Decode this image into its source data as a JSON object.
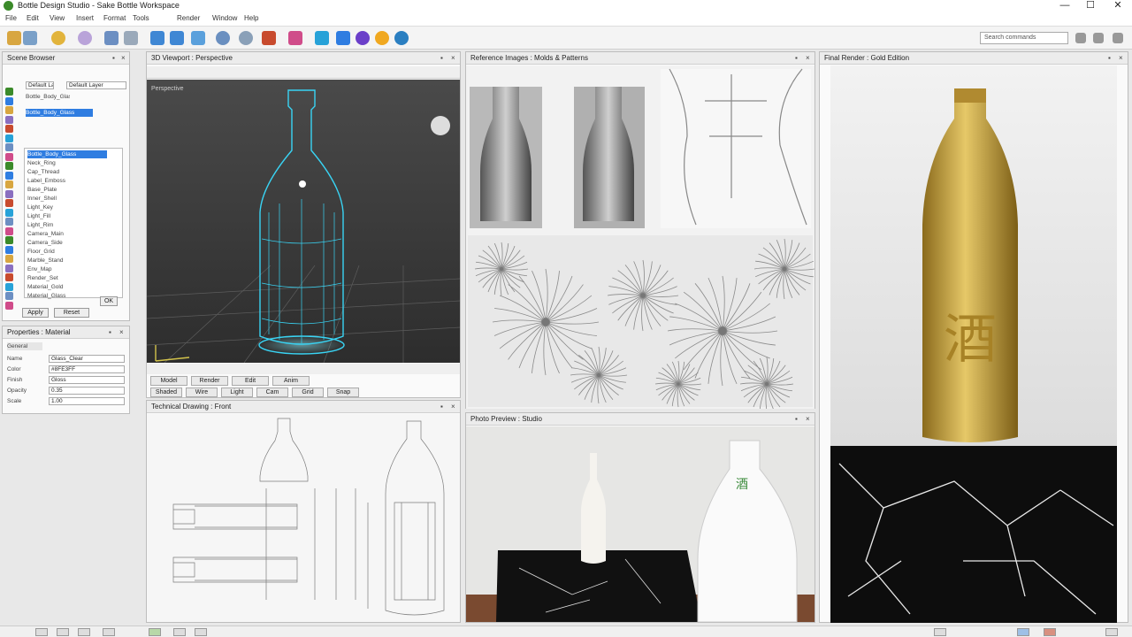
{
  "window": {
    "title": "Bottle Design Studio - Sake Bottle Workspace",
    "minimize": "—",
    "maximize": "☐",
    "close": "✕"
  },
  "menu": [
    "File",
    "Edit",
    "View",
    "Insert",
    "Format",
    "Tools",
    "Render",
    "Window",
    "Help"
  ],
  "search": {
    "value": "Search commands"
  },
  "left_panel": {
    "title": "Scene Browser",
    "selected_item": "Bottle_Body_Glass",
    "field_value": "Default Layer",
    "tree_items": [
      "Bottle_Body_Glass",
      "Neck_Ring",
      "Cap_Thread",
      "Label_Emboss",
      "Base_Plate",
      "Inner_Shell",
      "Light_Key",
      "Light_Fill",
      "Light_Rim",
      "Camera_Main",
      "Camera_Side",
      "Floor_Grid",
      "Marble_Stand",
      "Env_Map",
      "Render_Set",
      "Material_Gold",
      "Material_Glass"
    ],
    "buttons": [
      "Apply",
      "Reset",
      "OK"
    ]
  },
  "properties_panel": {
    "title": "Properties : Material",
    "section": "General",
    "labels": [
      "Name",
      "Color",
      "Finish",
      "Opacity",
      "Scale"
    ],
    "values": [
      "Glass_Clear",
      "#8FE3FF",
      "Gloss",
      "0.35",
      "1.00"
    ]
  },
  "viewport": {
    "title": "3D Viewport : Perspective",
    "hud_label": "Perspective",
    "tabs": [
      "Model",
      "Render",
      "Edit",
      "Anim"
    ],
    "subtabs": [
      "Shaded",
      "Wire",
      "Light",
      "Cam",
      "Grid",
      "Snap"
    ]
  },
  "drawing": {
    "title": "Technical Drawing : Front"
  },
  "references": {
    "title": "Reference Images : Molds & Patterns"
  },
  "photo": {
    "title": "Photo Preview : Studio"
  },
  "product": {
    "title": "Final Render : Gold Edition"
  },
  "colors": {
    "accent": "#2f7de1",
    "wire": "#39d4f4",
    "gold": "#c9a43a",
    "marble": "#111111"
  },
  "emblem": "酒"
}
